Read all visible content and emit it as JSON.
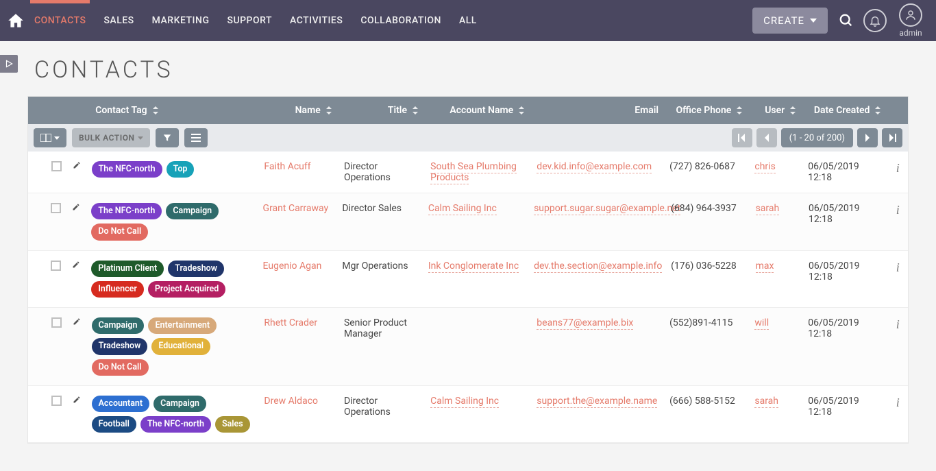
{
  "nav": {
    "items": [
      "CONTACTS",
      "SALES",
      "MARKETING",
      "SUPPORT",
      "ACTIVITIES",
      "COLLABORATION",
      "ALL"
    ],
    "active_index": 0
  },
  "header": {
    "create_label": "CREATE",
    "admin_label": "admin"
  },
  "page": {
    "title": "CONTACTS"
  },
  "columns": {
    "tag": "Contact Tag",
    "name": "Name",
    "title": "Title",
    "account": "Account Name",
    "email": "Email",
    "phone": "Office Phone",
    "user": "User",
    "date": "Date Created"
  },
  "toolbar": {
    "bulk_action_label": "BULK ACTION",
    "pager_text": "(1 - 20 of 200)"
  },
  "tag_colors": {
    "The NFC-north": "#7b3fc9",
    "Top": "#17a2b8",
    "Campaign": "#2f6b6b",
    "Do Not Call": "#e26a61",
    "Platinum Client": "#1e5a2a",
    "Tradeshow": "#20356a",
    "Influencer": "#d62b1f",
    "Project Acquired": "#b41f62",
    "Entertainment": "#d7a97a",
    "Educational": "#e1b13a",
    "Accountant": "#2d6fd1",
    "Football": "#1c4b83",
    "Sales": "#a99636"
  },
  "rows": [
    {
      "tags": [
        "The NFC-north",
        "Top"
      ],
      "name": "Faith Acuff",
      "title": "Director Operations",
      "account": "South Sea Plumbing Products",
      "email": "dev.kid.info@example.com",
      "phone": "(727) 826-0687",
      "user": "chris",
      "date": "06/05/2019 12:18"
    },
    {
      "tags": [
        "The NFC-north",
        "Campaign",
        "Do Not Call"
      ],
      "name": "Grant Carraway",
      "title": "Director Sales",
      "account": "Calm Sailing Inc",
      "email": "support.sugar.sugar@example.net",
      "phone": "(684) 964-3937",
      "user": "sarah",
      "date": "06/05/2019 12:18"
    },
    {
      "tags": [
        "Platinum Client",
        "Tradeshow",
        "Influencer",
        "Project Acquired"
      ],
      "name": "Eugenio Agan",
      "title": "Mgr Operations",
      "account": "Ink Conglomerate Inc",
      "email": "dev.the.section@example.info",
      "phone": "(176) 036-5228",
      "user": "max",
      "date": "06/05/2019 12:18"
    },
    {
      "tags": [
        "Campaign",
        "Entertainment",
        "Tradeshow",
        "Educational",
        "Do Not Call"
      ],
      "name": "Rhett Crader",
      "title": "Senior Product Manager",
      "account": "",
      "email": "beans77@example.bix",
      "phone": "(552)891-4115",
      "user": "will",
      "date": "06/05/2019 12:18"
    },
    {
      "tags": [
        "Accountant",
        "Campaign",
        "Football",
        "The NFC-north",
        "Sales"
      ],
      "name": "Drew Aldaco",
      "title": "Director Operations",
      "account": "Calm Sailing Inc",
      "email": "support.the@example.name",
      "phone": "(666) 588-5152",
      "user": "sarah",
      "date": "06/05/2019 12:18"
    }
  ]
}
